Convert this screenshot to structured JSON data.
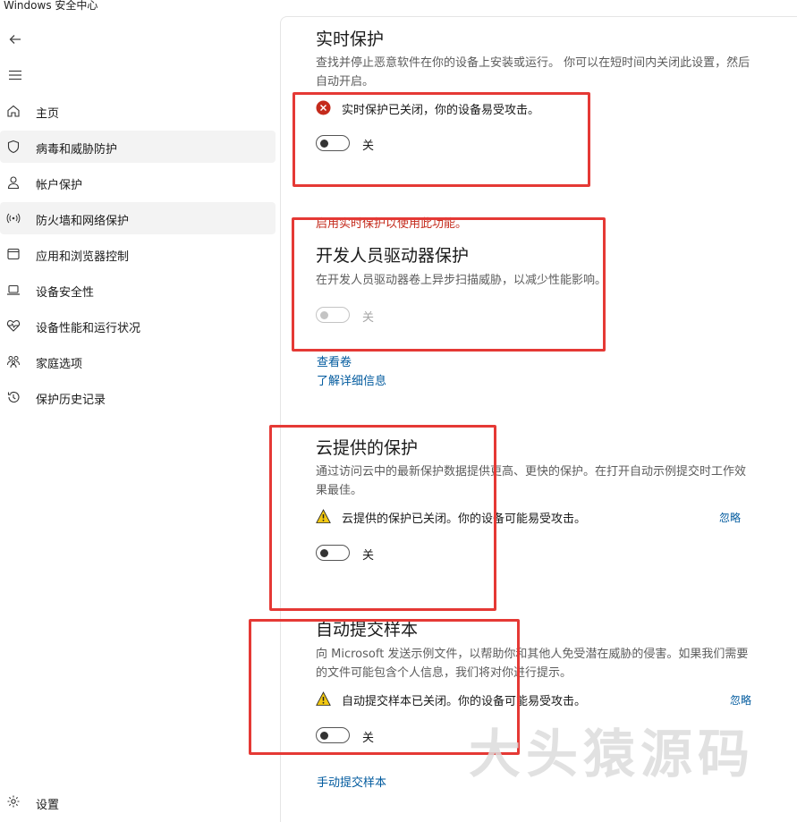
{
  "window": {
    "title": "Windows 安全中心"
  },
  "sidebar": {
    "items": [
      {
        "label": "主页",
        "icon": "home-icon"
      },
      {
        "label": "病毒和威胁防护",
        "icon": "shield-icon",
        "selected": true
      },
      {
        "label": "帐户保护",
        "icon": "person-icon"
      },
      {
        "label": "防火墙和网络保护",
        "icon": "antenna-icon",
        "selected": true
      },
      {
        "label": "应用和浏览器控制",
        "icon": "window-icon"
      },
      {
        "label": "设备安全性",
        "icon": "laptop-icon"
      },
      {
        "label": "设备性能和运行状况",
        "icon": "heart-pulse-icon"
      },
      {
        "label": "家庭选项",
        "icon": "family-icon"
      },
      {
        "label": "保护历史记录",
        "icon": "history-icon"
      }
    ],
    "settings_label": "设置"
  },
  "realtime": {
    "title": "实时保护",
    "desc": "查找并停止恶意软件在你的设备上安装或运行。 你可以在短时间内关闭此设置，然后自动开启。",
    "status": "实时保护已关闭，你的设备易受攻击。",
    "toggle_label": "关",
    "error": "启用实时保护以使用此功能。"
  },
  "devdrive": {
    "title": "开发人员驱动器保护",
    "desc": "在开发人员驱动器卷上异步扫描威胁，以减少性能影响。",
    "toggle_label": "关",
    "link_view": "查看卷",
    "link_learn": "了解详细信息"
  },
  "cloud": {
    "title": "云提供的保护",
    "desc": "通过访问云中的最新保护数据提供更高、更快的保护。在打开自动示例提交时工作效果最佳。",
    "status": "云提供的保护已关闭。你的设备可能易受攻击。",
    "ignore": "忽略",
    "toggle_label": "关"
  },
  "sample": {
    "title": "自动提交样本",
    "desc": "向 Microsoft 发送示例文件，以帮助你和其他人免受潜在威胁的侵害。如果我们需要的文件可能包含个人信息，我们将对你进行提示。",
    "status": "自动提交样本已关闭。你的设备可能易受攻击。",
    "ignore": "忽略",
    "toggle_label": "关",
    "link_manual": "手动提交样本"
  },
  "watermark": "大头猿源码",
  "colors": {
    "accent_link": "#005a9e",
    "error_red": "#c42b1c",
    "warning_yellow": "#f2c811",
    "highlight_box": "#e53935"
  }
}
